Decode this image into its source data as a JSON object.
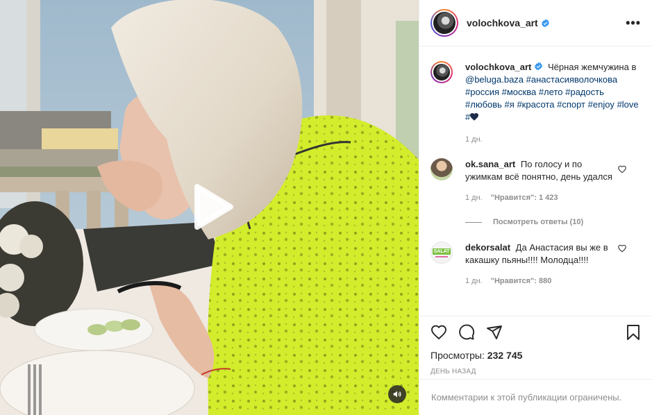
{
  "post": {
    "author": "volochkova_art",
    "author_verified": true,
    "more_icon": "more-horizontal-icon",
    "caption": {
      "user": "volochkova_art",
      "text_before": "Чёрная жемчужина в",
      "mention": "@beluga.baza",
      "hashtags": [
        "#анастасияволочкова",
        "#россия",
        "#москва",
        "#лето",
        "#радость",
        "#любовь",
        "#я",
        "#красота",
        "#спорт",
        "#enjoy",
        "#love",
        "#"
      ],
      "tail_icon": "black-heart-icon",
      "time": "1 дн."
    },
    "comments": [
      {
        "user": "ok.sana_art",
        "text": "По голосу и по ужимкам всё понятно, день удался",
        "time": "1 дн.",
        "likes": "\"Нравится\": 1 423",
        "replies": "Посмотреть ответы (10)"
      },
      {
        "user": "dekorsalat",
        "text": "Да Анастасия вы же в какашку пьяны!!!! Молодца!!!!",
        "time": "1 дн.",
        "likes": "\"Нравится\": 880",
        "avatar_text": "SALAT"
      }
    ],
    "views_label": "Просмотры:",
    "views_value": "232 745",
    "posted": "День назад",
    "comments_disabled": "Комментарии к этой публикации ограничены.",
    "icons": [
      "heart-icon",
      "comment-icon",
      "share-icon",
      "bookmark-icon",
      "play-icon",
      "sound-icon"
    ]
  },
  "colors": {
    "link": "#00376b",
    "muted": "#8e8e8e",
    "verified": "#3897f0",
    "dress": "#d2ea2a"
  }
}
